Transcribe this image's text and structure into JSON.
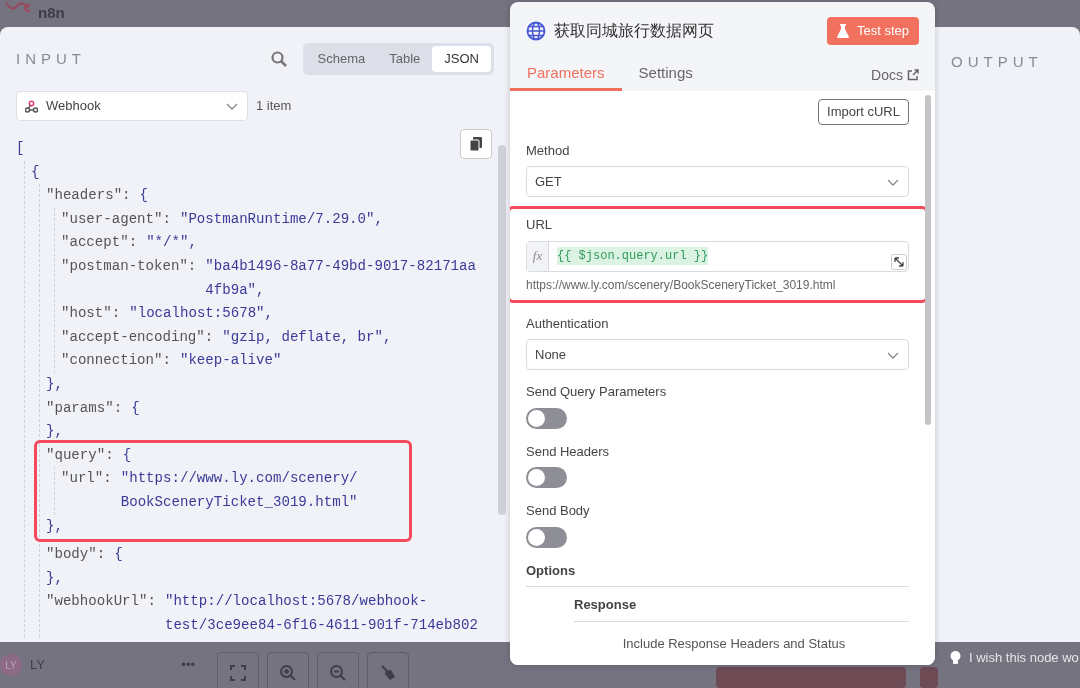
{
  "app": {
    "logo_text": "n8n"
  },
  "input": {
    "title": "INPUT",
    "views": [
      {
        "label": "Schema",
        "selected": false
      },
      {
        "label": "Table",
        "selected": false
      },
      {
        "label": "JSON",
        "selected": true
      }
    ],
    "source": {
      "value": "Webhook"
    },
    "item_count": "1 item",
    "code": [
      {
        "value": [
          "["
        ],
        "children": [
          {
            "value": [
              "{"
            ],
            "children": [
              {
                "key": "\"headers\":",
                "value": [
                  "{"
                ],
                "close": "},",
                "children": [
                  {
                    "key": "\"user-agent\":",
                    "value": [
                      "\"PostmanRuntime/7.29.0\","
                    ]
                  },
                  {
                    "key": "\"accept\":",
                    "value": [
                      "\"*/*\","
                    ]
                  },
                  {
                    "key": "\"postman-token\":",
                    "value": [
                      "\"ba4b1496-8a77-49bd-9017-82171aa",
                      "4fb9a\","
                    ]
                  },
                  {
                    "key": "\"host\":",
                    "value": [
                      "\"localhost:5678\","
                    ]
                  },
                  {
                    "key": "\"accept-encoding\":",
                    "value": [
                      "\"gzip, deflate, br\","
                    ]
                  },
                  {
                    "key": "\"connection\":",
                    "value": [
                      "\"keep-alive\""
                    ]
                  }
                ]
              },
              {
                "key": "\"params\":",
                "value": [
                  "{"
                ],
                "close": "},"
              },
              {
                "key": "\"query\":",
                "value": [
                  "{"
                ],
                "close": "},",
                "highlighted": true,
                "children": [
                  {
                    "key": "\"url\":",
                    "value": [
                      "\"https://www.ly.com/scenery/",
                      "BookSceneryTicket_3019.html\""
                    ]
                  }
                ]
              },
              {
                "key": "\"body\":",
                "value": [
                  "{"
                ],
                "close": "},"
              },
              {
                "key": "\"webhookUrl\":",
                "value": [
                  "\"http://localhost:5678/webhook-",
                  "test/3ce9ee84-6f16-4611-901f-714eb802"
                ]
              }
            ]
          }
        ]
      }
    ]
  },
  "node": {
    "title": "获取同城旅行数据网页",
    "test_button": "Test step",
    "tabs": [
      {
        "label": "Parameters",
        "selected": true
      },
      {
        "label": "Settings",
        "selected": false
      }
    ],
    "docs_link": "Docs",
    "import_button": "Import cURL",
    "fields": [
      {
        "kind": "select",
        "label": "Method",
        "value": "GET"
      },
      {
        "kind": "expression",
        "label": "URL",
        "fx": "fx",
        "value": "{{ $json.query.url }}",
        "hint": "https://www.ly.com/scenery/BookSceneryTicket_3019.html",
        "highlighted": true
      },
      {
        "kind": "select",
        "label": "Authentication",
        "value": "None"
      },
      {
        "kind": "toggle",
        "label": "Send Query Parameters",
        "on": false
      },
      {
        "kind": "toggle",
        "label": "Send Headers",
        "on": false
      },
      {
        "kind": "toggle",
        "label": "Send Body",
        "on": false
      }
    ],
    "options_title": "Options",
    "options_group": "Response",
    "options_item": "Include Response Headers and Status"
  },
  "output": {
    "title": "OUTPUT"
  },
  "footer": {
    "avatar": "LY",
    "user": "LY",
    "menu": "•••",
    "tip": "I wish this node wo"
  }
}
